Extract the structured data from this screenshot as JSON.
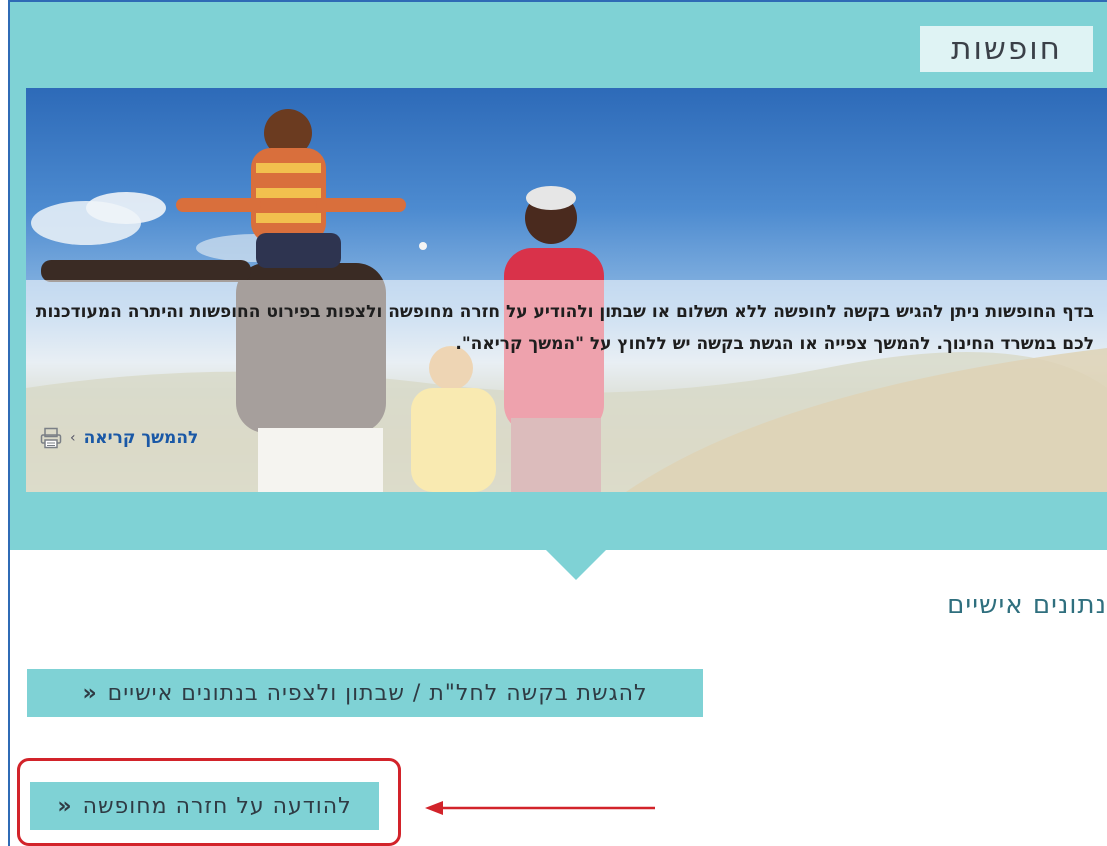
{
  "hero": {
    "title": "חופשות",
    "description": "בדף החופשות ניתן להגיש בקשה לחופשה ללא תשלום או שבתון ולהודיע על חזרה מחופשה ולצפות בפירוט החופשות והיתרה המעודכנות לכם במשרד החינוך. להמשך צפייה או הגשת בקשה יש ללחוץ על \"המשך קריאה\".",
    "read_more": "להמשך קריאה",
    "separator": "‹",
    "print_icon": "printer-icon"
  },
  "section": {
    "title": "נתונים אישיים"
  },
  "buttons": {
    "leave_request": "להגשת בקשה לחל\"ת / שבתון ולצפיה בנתונים אישיים",
    "return_notice": "להודעה על חזרה מחופשה",
    "chevron": "«"
  },
  "colors": {
    "teal": "#7fd2d5",
    "highlight_red": "#d2232a",
    "link_blue": "#1a58a6"
  }
}
